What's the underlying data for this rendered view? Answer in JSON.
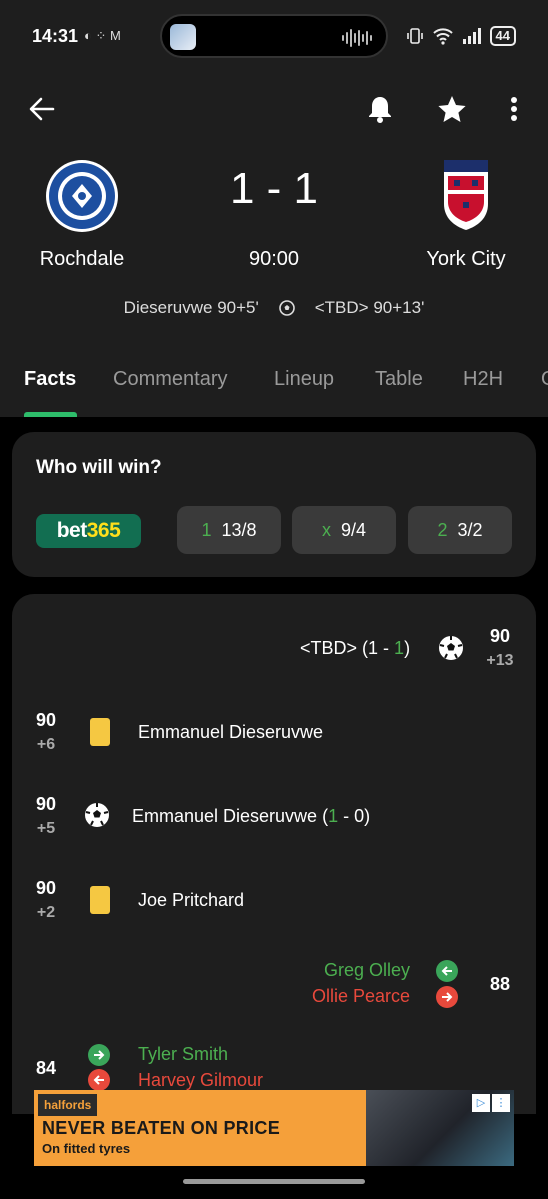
{
  "status_bar": {
    "time": "14:31",
    "left_icons": "◐ ⁘ M",
    "battery": "44"
  },
  "header": {
    "home_team": "Rochdale",
    "away_team": "York City",
    "score": "1 - 1",
    "clock": "90:00",
    "home_scorer": "Dieseruvwe 90+5'",
    "away_scorer": "<TBD> 90+13'"
  },
  "tabs": [
    "Facts",
    "Commentary",
    "Lineup",
    "Table",
    "H2H",
    "O"
  ],
  "win_card": {
    "title": "Who will win?",
    "bookmaker_a": "bet",
    "bookmaker_b": "365",
    "odds": [
      {
        "key": "1",
        "value": "13/8"
      },
      {
        "key": "x",
        "value": "9/4"
      },
      {
        "key": "2",
        "value": "3/2"
      }
    ]
  },
  "events": {
    "e1": {
      "min": "90",
      "add": "+13",
      "name": "<TBD>",
      "score_pre": " (1 - ",
      "score_hl": "1",
      "score_post": ")"
    },
    "e2": {
      "min": "90",
      "add": "+6",
      "name": "Emmanuel Dieseruvwe"
    },
    "e3": {
      "min": "90",
      "add": "+5",
      "name": "Emmanuel Dieseruvwe",
      "score_pre": " (",
      "score_hl": "1",
      "score_post": " - 0)"
    },
    "e4": {
      "min": "90",
      "add": "+2",
      "name": "Joe Pritchard"
    },
    "e5": {
      "min": "88",
      "in": "Greg Olley",
      "out": "Ollie Pearce"
    },
    "e6": {
      "min": "84",
      "in": "Tyler Smith",
      "out": "Harvey Gilmour"
    }
  },
  "ad": {
    "brand": "halfords",
    "headline": "NEVER BEATEN ON PRICE",
    "subline": "On fitted tyres"
  },
  "colors": {
    "accent": "#2ebd6b",
    "yellow_card": "#f5c842",
    "sub_in": "#4caf50",
    "sub_out": "#e8493c",
    "background": "#1e1e1e"
  }
}
